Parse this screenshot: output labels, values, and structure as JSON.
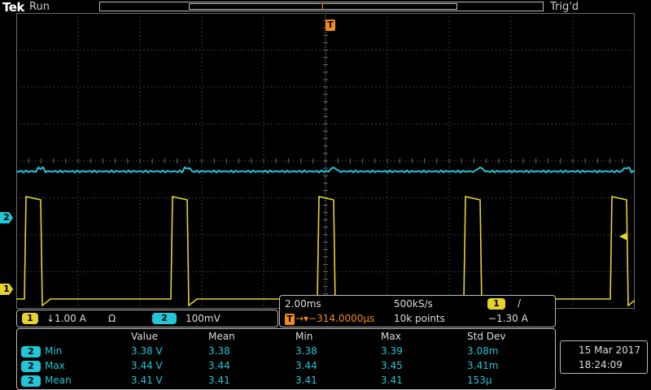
{
  "header": {
    "brand": "Tek",
    "run_state": "Run",
    "trigger_state": "Trig'd",
    "trigger_top_marker": "T"
  },
  "markers": {
    "ch2": "2",
    "ch1": "1",
    "trigger": "T"
  },
  "channels": {
    "ch1": {
      "label": "1",
      "scale": "↓1.00 A",
      "unit_symbol": "Ω"
    },
    "ch2": {
      "label": "2",
      "scale": "100mV"
    }
  },
  "timebase": {
    "time_div": "2.00ms",
    "sample_rate": "500kS/s",
    "trigger_source": "1",
    "trigger_slope": "/",
    "trigger_position_marker": "T",
    "trigger_position": "→▾−314.0000µs",
    "record_length": "10k points",
    "trigger_level": "−1.30 A"
  },
  "measurements": {
    "headers": [
      "Value",
      "Mean",
      "Min",
      "Max",
      "Std Dev"
    ],
    "rows": [
      {
        "source": "2",
        "name": "Min",
        "cells": [
          "3.38 V",
          "3.38",
          "3.38",
          "3.39",
          "3.08m"
        ]
      },
      {
        "source": "2",
        "name": "Max",
        "cells": [
          "3.44 V",
          "3.44",
          "3.44",
          "3.45",
          "3.41m"
        ]
      },
      {
        "source": "2",
        "name": "Mean",
        "cells": [
          "3.41 V",
          "3.41",
          "3.41",
          "3.41",
          "153µ"
        ]
      }
    ]
  },
  "datetime": {
    "date": "15 Mar  2017",
    "time": "18:24:09"
  },
  "colors": {
    "ch1": "#e5d230",
    "ch2": "#22c6d6",
    "trigger": "#f08c1a",
    "grid": "#6a6a6a"
  }
}
